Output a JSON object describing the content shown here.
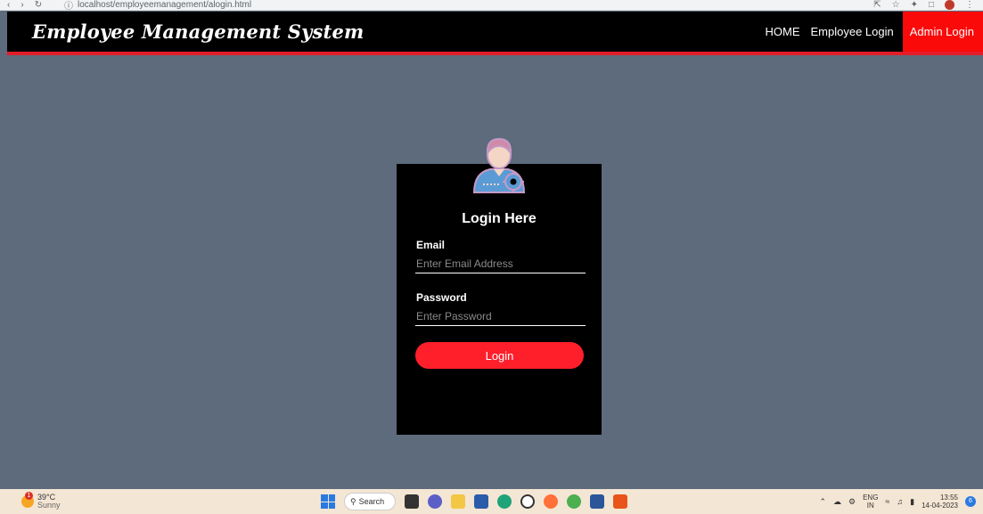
{
  "browser": {
    "url": "localhost/employeemanagement/alogin.html"
  },
  "navbar": {
    "brand": "Employee Management System",
    "links": [
      {
        "label": "HOME"
      },
      {
        "label": "Employee Login"
      },
      {
        "label": "Admin Login",
        "active": true
      }
    ]
  },
  "login": {
    "title": "Login Here",
    "email_label": "Email",
    "email_placeholder": "Enter Email Address",
    "email_value": "",
    "password_label": "Password",
    "password_placeholder": "Enter Password",
    "password_value": "",
    "button_label": "Login"
  },
  "colors": {
    "background": "#5d6b7c",
    "navbar": "#000000",
    "accent": "#e21d2a",
    "button": "#ff1f2b"
  },
  "taskbar": {
    "weather_temp": "39°C",
    "weather_desc": "Sunny",
    "weather_badge": "1",
    "search_label": "Search",
    "lang_top": "ENG",
    "lang_bottom": "IN",
    "time": "13:55",
    "date": "14-04-2023",
    "notification_count": "6"
  }
}
